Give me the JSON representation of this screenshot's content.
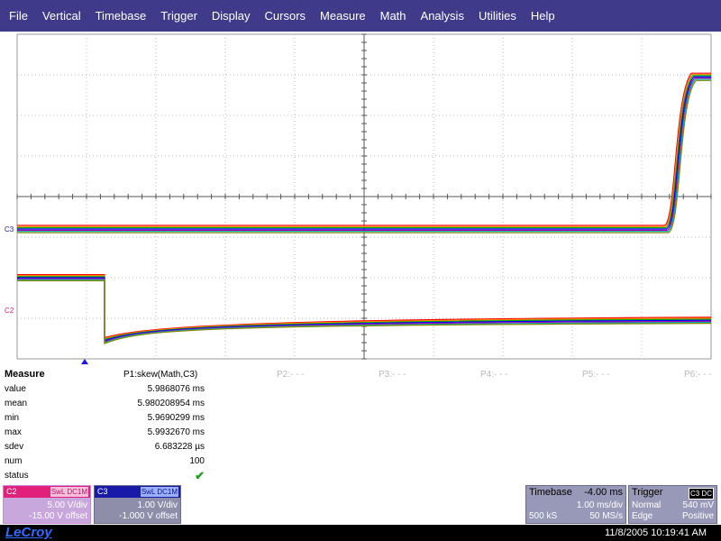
{
  "menu": [
    "File",
    "Vertical",
    "Timebase",
    "Trigger",
    "Display",
    "Cursors",
    "Measure",
    "Math",
    "Analysis",
    "Utilities",
    "Help"
  ],
  "grid": {
    "channel_markers": {
      "c3": "C3",
      "c2": "C2"
    }
  },
  "traces": {
    "colors": [
      "#ff0000",
      "#ff8800",
      "#00aa00",
      "#0000ff",
      "#aa00aa",
      "#00aaaa",
      "#888800"
    ],
    "c3": {
      "low_div": 0.8,
      "high_div": -2.95,
      "edge_start_ms": 5.45,
      "edge_end_ms": 5.75
    },
    "c2": {
      "pre_div": 2.0,
      "drop_time_ms": 0.0,
      "drop_div": 3.55,
      "settle_div": 3.1
    }
  },
  "measure": {
    "heading": "Measure",
    "param_title": "P1:skew(Math,C3)",
    "rows": [
      {
        "label": "value",
        "value": "5.9868076 ms"
      },
      {
        "label": "mean",
        "value": "5.980208954 ms"
      },
      {
        "label": "min",
        "value": "5.9690299 ms"
      },
      {
        "label": "max",
        "value": "5.9932670 ms"
      },
      {
        "label": "sdev",
        "value": "6.683228 µs"
      },
      {
        "label": "num",
        "value": "100"
      },
      {
        "label": "status",
        "value": "✔"
      }
    ],
    "slots": [
      "P2:- - -",
      "P3:- - -",
      "P4:- - -",
      "P5:- - -",
      "P6:- - -"
    ]
  },
  "c2_desc": {
    "tag": "C2",
    "badge": "SwL DC1M",
    "line1": "5.00 V/div",
    "line2": "-15.00 V offset"
  },
  "c3_desc": {
    "tag": "C3",
    "badge": "SwL DC1M",
    "line1": "1.00 V/div",
    "line2": "-1.000 V offset"
  },
  "timebase": {
    "title": "Timebase",
    "offset": "-4.00 ms",
    "per_div": "1.00 ms/div",
    "samples": "500 kS",
    "rate": "50 MS/s"
  },
  "trigger": {
    "title": "Trigger",
    "badge": "C3 DC",
    "mode": "Normal",
    "level": "540 mV",
    "type": "Edge",
    "slope": "Positive"
  },
  "footer": {
    "brand": "LeCroy",
    "timestamp": "11/8/2005 10:19:41 AM"
  }
}
